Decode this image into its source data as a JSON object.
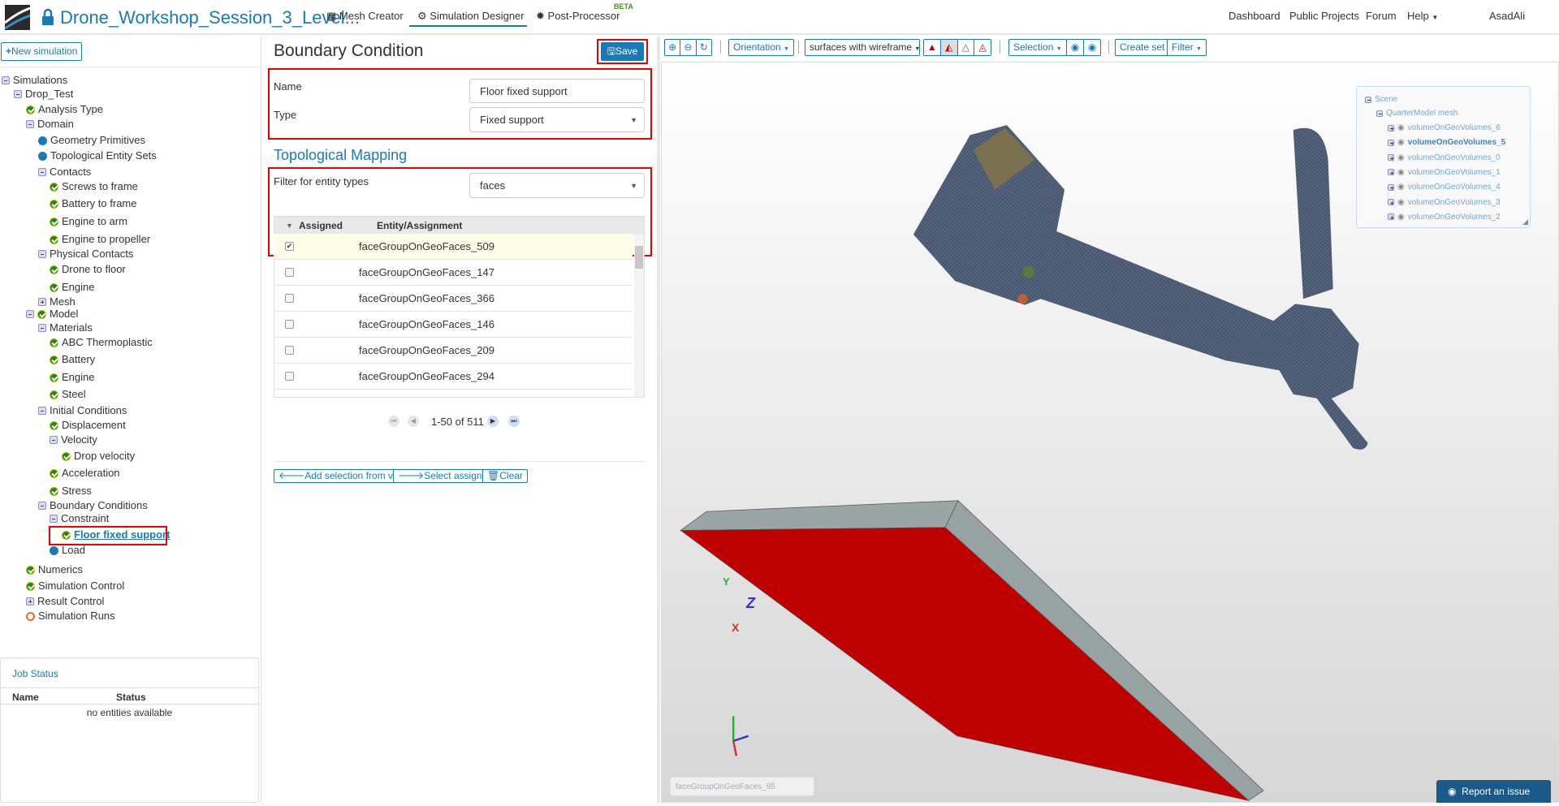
{
  "header": {
    "project_title": "Drone_Workshop_Session_3_Level...",
    "tabs": [
      {
        "label": "Mesh Creator",
        "icon": "grid-icon"
      },
      {
        "label": "Simulation Designer",
        "icon": "gears-icon",
        "active": true
      },
      {
        "label": "Post-Processor",
        "icon": "gear-icon",
        "badge": "BETA"
      }
    ],
    "links": [
      "Dashboard",
      "Public Projects",
      "Forum",
      "Help"
    ],
    "user": "AsadAli"
  },
  "sidebar": {
    "new_simulation": "New simulation",
    "tree": [
      {
        "label": "Simulations",
        "level": 0,
        "icon": "minus"
      },
      {
        "label": "Drop_Test",
        "level": 1,
        "icon": "minus"
      },
      {
        "label": "Analysis Type",
        "level": 2,
        "icon": "check"
      },
      {
        "label": "Domain",
        "level": 2,
        "icon": "minus"
      },
      {
        "label": "Geometry Primitives",
        "level": 3,
        "icon": "dot"
      },
      {
        "label": "Topological Entity Sets",
        "level": 3,
        "icon": "dot"
      },
      {
        "label": "Contacts",
        "level": 3,
        "icon": "minus"
      },
      {
        "label": "Screws to frame",
        "level": 4,
        "icon": "check"
      },
      {
        "label": "Battery to frame",
        "level": 4,
        "icon": "check"
      },
      {
        "label": "Engine to arm",
        "level": 4,
        "icon": "check"
      },
      {
        "label": "Engine to propeller",
        "level": 4,
        "icon": "check"
      },
      {
        "label": "Physical Contacts",
        "level": 3,
        "icon": "minus"
      },
      {
        "label": "Drone to floor",
        "level": 4,
        "icon": "check"
      },
      {
        "label": "Engine",
        "level": 4,
        "icon": "check"
      },
      {
        "label": "Mesh",
        "level": 3,
        "icon": "plus"
      },
      {
        "label": "Model",
        "level": 2,
        "icon": "minus",
        "icon2": "check"
      },
      {
        "label": "Materials",
        "level": 3,
        "icon": "minus"
      },
      {
        "label": "ABC Thermoplastic",
        "level": 4,
        "icon": "check"
      },
      {
        "label": "Battery",
        "level": 4,
        "icon": "check"
      },
      {
        "label": "Engine",
        "level": 4,
        "icon": "check"
      },
      {
        "label": "Steel",
        "level": 4,
        "icon": "check"
      },
      {
        "label": "Initial Conditions",
        "level": 3,
        "icon": "minus"
      },
      {
        "label": "Displacement",
        "level": 4,
        "icon": "check"
      },
      {
        "label": "Velocity",
        "level": 4,
        "icon": "minus"
      },
      {
        "label": "Drop velocity",
        "level": 5,
        "icon": "check"
      },
      {
        "label": "Acceleration",
        "level": 4,
        "icon": "check"
      },
      {
        "label": "Stress",
        "level": 4,
        "icon": "check"
      },
      {
        "label": "Boundary Conditions",
        "level": 3,
        "icon": "minus"
      },
      {
        "label": "Constraint",
        "level": 4,
        "icon": "minus"
      },
      {
        "label": "Floor fixed support",
        "level": 5,
        "icon": "check",
        "selected": true
      },
      {
        "label": "Load",
        "level": 4,
        "icon": "dot"
      },
      {
        "label": "Numerics",
        "level": 2,
        "icon": "check"
      },
      {
        "label": "Simulation Control",
        "level": 2,
        "icon": "check"
      },
      {
        "label": "Result Control",
        "level": 2,
        "icon": "plus"
      },
      {
        "label": "Simulation Runs",
        "level": 2,
        "icon": "ring"
      }
    ],
    "job_status": {
      "title": "Job Status",
      "columns": [
        "Name",
        "Status"
      ],
      "empty": "no entities available"
    }
  },
  "panel": {
    "title": "Boundary Condition",
    "save": "Save",
    "name_label": "Name",
    "name_value": "Floor fixed support",
    "type_label": "Type",
    "type_value": "Fixed support",
    "mapping_title": "Topological Mapping",
    "filter_label": "Filter for entity types",
    "filter_value": "faces",
    "table": {
      "columns": [
        "Assigned",
        "Entity/Assignment"
      ],
      "rows": [
        {
          "entity": "faceGroupOnGeoFaces_509",
          "assigned": true
        },
        {
          "entity": "faceGroupOnGeoFaces_147",
          "assigned": false
        },
        {
          "entity": "faceGroupOnGeoFaces_366",
          "assigned": false
        },
        {
          "entity": "faceGroupOnGeoFaces_146",
          "assigned": false
        },
        {
          "entity": "faceGroupOnGeoFaces_209",
          "assigned": false
        },
        {
          "entity": "faceGroupOnGeoFaces_294",
          "assigned": false
        }
      ]
    },
    "pagination": "1-50 of 511",
    "actions": [
      "Add selection from viewer",
      "Select assignment",
      "Clear"
    ]
  },
  "viewer": {
    "toolbar": {
      "orientation": "Orientation",
      "render_mode": "surfaces with wireframe",
      "selection": "Selection",
      "create_set": "Create set",
      "filter": "Filter"
    },
    "scene": {
      "root": "Scene",
      "mesh": "QuarterModel mesh",
      "volumes": [
        "volumeOnGeoVolumes_6",
        "volumeOnGeoVolumes_5",
        "volumeOnGeoVolumes_0",
        "volumeOnGeoVolumes_1",
        "volumeOnGeoVolumes_4",
        "volumeOnGeoVolumes_3",
        "volumeOnGeoVolumes_2"
      ],
      "bold_index": 1
    },
    "axes": {
      "x": "X",
      "y": "Y",
      "z": "Z"
    },
    "hover_placeholder": "faceGroupOnGeoFaces_95",
    "report": "Report an issue"
  },
  "colors": {
    "accent": "#1a7ab5",
    "assigned": "#c00000",
    "mesh": "#4f5f78",
    "highlight": "#e00000"
  }
}
